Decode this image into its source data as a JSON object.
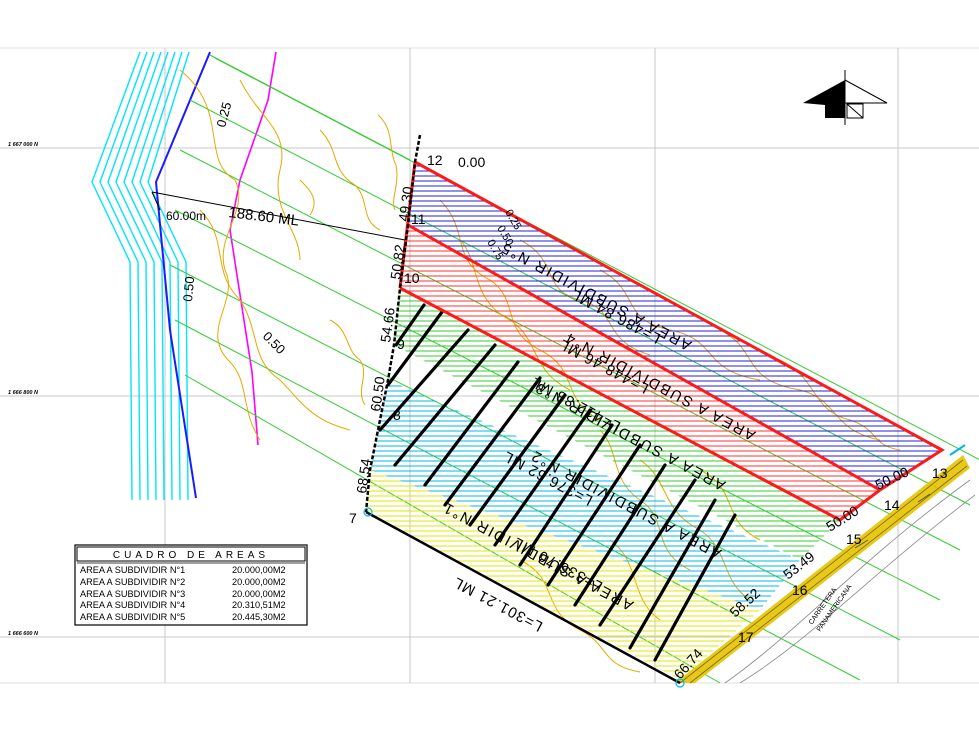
{
  "colors": {
    "grid": "#c8c8c8",
    "river": "#00e5ff",
    "river_edge": "#1a1aff",
    "green_lines": "#33cc33",
    "contours": "#e6a800",
    "magenta": "#ff00ff",
    "lot_boundary": "#ff1a1a",
    "lot5_hatch": "#2222dd",
    "lot4_hatch": "#ff3333",
    "lot3_hatch": "#33cc33",
    "lot2_hatch": "#00b8e6",
    "lot1_hatch": "#e6e600",
    "road": "#e6c200"
  },
  "grid_labels": {
    "n1": "1 667 000 N",
    "n2": "1 666 800 N",
    "n3": "1 666 600 N"
  },
  "contour_labels": {
    "a": "0.25",
    "b": "0.50",
    "c": "0.50",
    "d": "0.25",
    "e": "0.50",
    "f": "0.75"
  },
  "measures": {
    "offset": "60.00m",
    "width": "188.60 ML",
    "seg_12_zero": "0.00",
    "seg_49_30": "49.30",
    "seg_50_82": "50.82",
    "seg_54_66": "54.66",
    "seg_60_50": "60.50",
    "seg_68_54": "68.54",
    "seg_50_00_a": "50.00",
    "seg_50_00_b": "50.00",
    "seg_53_49": "53.49",
    "seg_58_52": "58.52",
    "seg_66_74": "66.74"
  },
  "vertices": {
    "v7": "7",
    "v8": "8",
    "v9": "9",
    "v10": "10",
    "v11": "11",
    "v12": "12",
    "v13": "13",
    "v14": "14",
    "v15": "15",
    "v16": "16",
    "v17": "17"
  },
  "lots": {
    "l5_name": "AREA A SUBDIVIDIR N°5",
    "l5_len": "L=486.84 ML",
    "l4_name": "AREA A SUBDIVIDIR N°4",
    "l4_len": "L=448.46 ML",
    "l3_name": "AREA A SUBDIVIDIR N°3",
    "l3_len": "L=412.88 ML",
    "l2_name": "AREA A SUBDIVIDIR N°2",
    "l2_len": "L=376.62 ML",
    "l1_name": "AREA A SUBDIVIDIR N°1",
    "l1_len": "L=336.70 ML",
    "base_len": "L=301.21 ML"
  },
  "road": {
    "line1": "CARRETERA",
    "line2": "PANAMERICANA"
  },
  "area_table": {
    "title": "CUADRO DE AREAS",
    "rows": [
      {
        "name": "AREA A SUBDIVIDIR N°1",
        "value": "20.000,00M2"
      },
      {
        "name": "AREA A SUBDIVIDIR N°2",
        "value": "20.000,00M2"
      },
      {
        "name": "AREA A SUBDIVIDIR N°3",
        "value": "20.000,00M2"
      },
      {
        "name": "AREA A SUBDIVIDIR N°4",
        "value": "20.310,51M2"
      },
      {
        "name": "AREA A SUBDIVIDIR N°5",
        "value": "20.445,30M2"
      }
    ]
  }
}
